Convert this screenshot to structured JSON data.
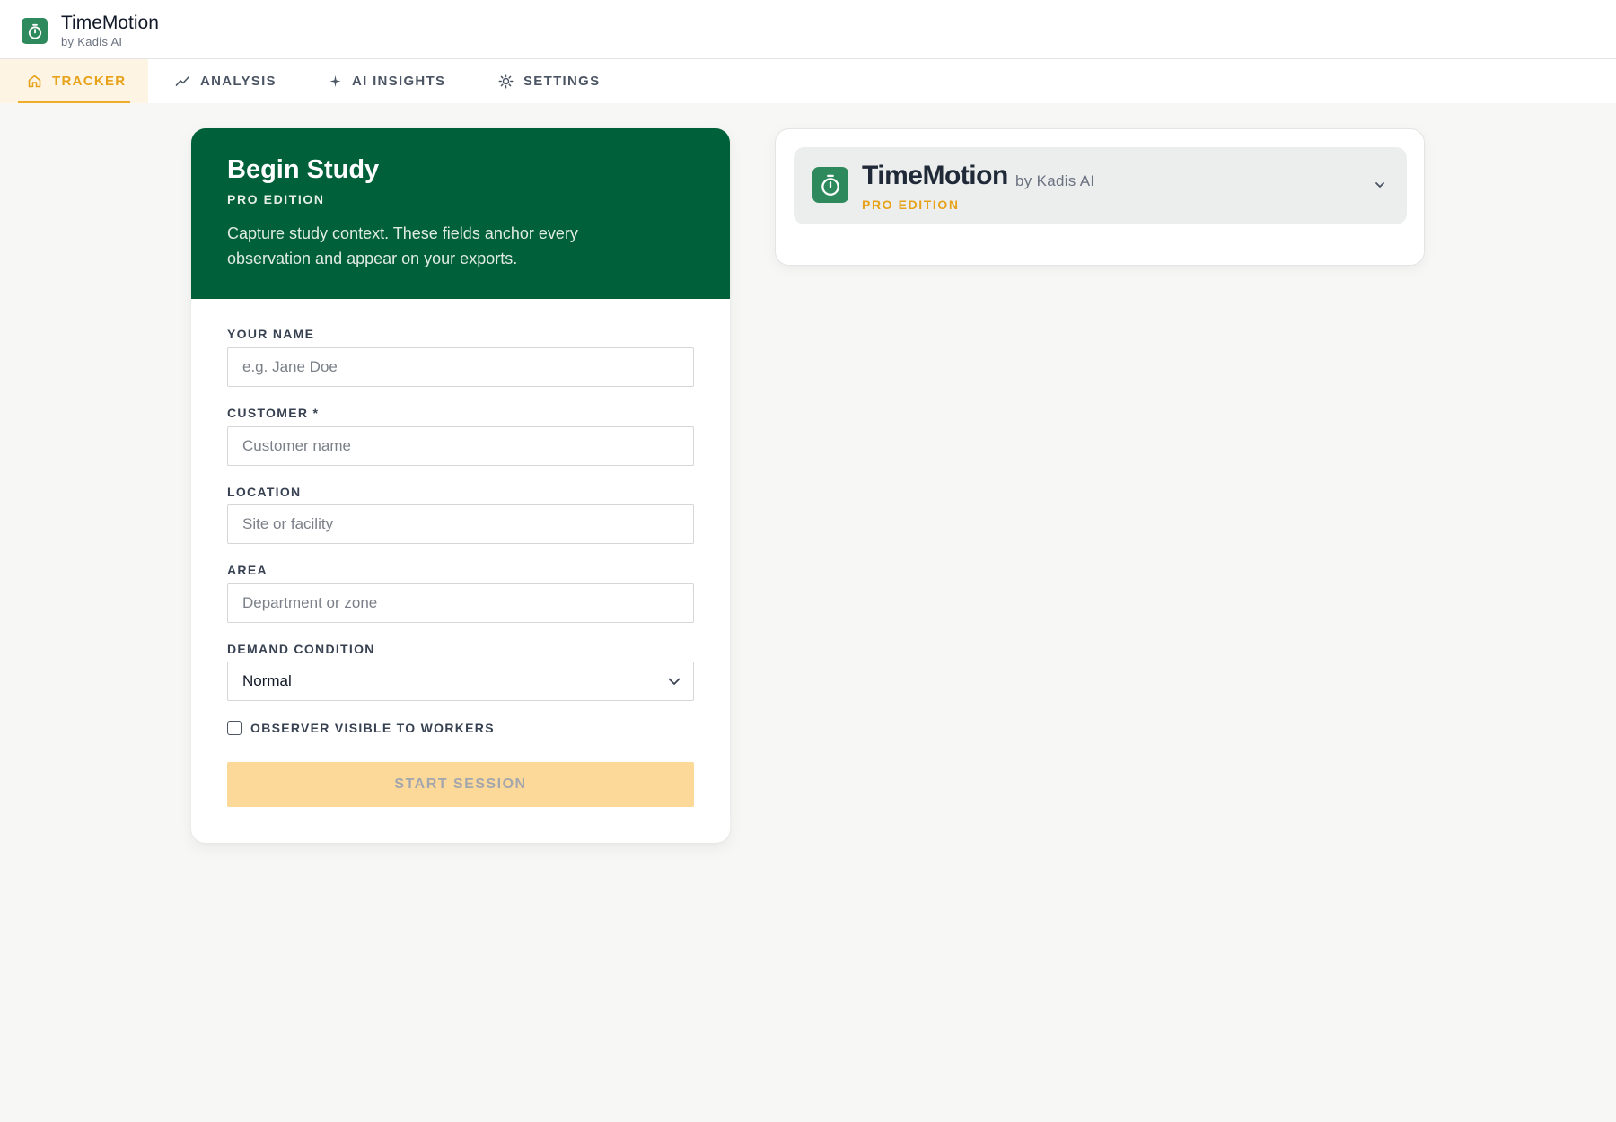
{
  "app": {
    "title": "TimeMotion",
    "subtitle": "by Kadis AI",
    "brand_color": "#2e8a5c",
    "accent_color": "#e8a21a",
    "logo_icon": "stopwatch-icon"
  },
  "nav": {
    "tabs": [
      {
        "label": "TRACKER",
        "icon": "home-icon",
        "active": true
      },
      {
        "label": "ANALYSIS",
        "icon": "trend-line-icon",
        "active": false
      },
      {
        "label": "AI INSIGHTS",
        "icon": "sparkle-icon",
        "active": false
      },
      {
        "label": "SETTINGS",
        "icon": "gear-icon",
        "active": false
      }
    ]
  },
  "study_form": {
    "title": "Begin Study",
    "edition": "PRO EDITION",
    "description": "Capture study context. These fields anchor every observation and appear on your exports.",
    "header_color": "#006039",
    "fields": [
      {
        "label": "YOUR NAME",
        "placeholder": "e.g. Jane Doe",
        "value": ""
      },
      {
        "label": "CUSTOMER *",
        "placeholder": "Customer name",
        "value": ""
      },
      {
        "label": "LOCATION",
        "placeholder": "Site or facility",
        "value": ""
      },
      {
        "label": "AREA",
        "placeholder": "Department or zone",
        "value": ""
      }
    ],
    "demand_condition": {
      "label": "DEMAND CONDITION",
      "selected": "Normal"
    },
    "observer_checkbox": {
      "label": "OBSERVER VISIBLE TO WORKERS",
      "checked": false
    },
    "start_button": {
      "label": "START SESSION",
      "enabled": false
    }
  },
  "info_panel": {
    "title": "TimeMotion",
    "subtitle": "by Kadis AI",
    "edition": "PRO EDITION",
    "expanded": false
  }
}
